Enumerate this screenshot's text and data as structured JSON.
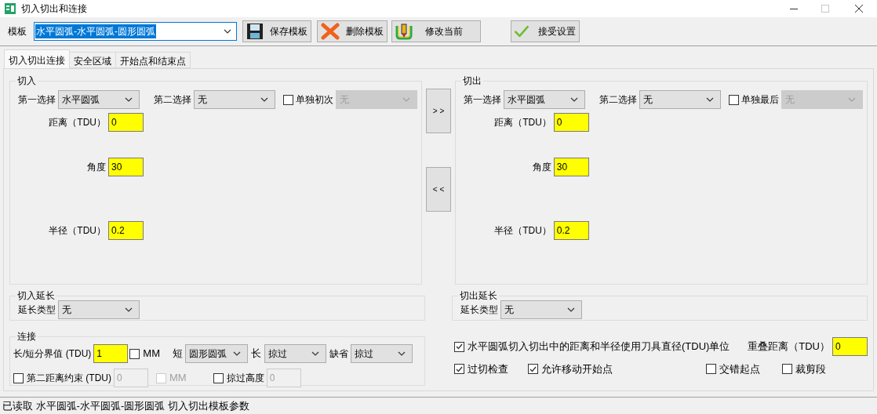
{
  "window": {
    "title": "切入切出和连接"
  },
  "toolbar": {
    "template_label": "模板",
    "template": {
      "value": "水平圆弧-水平圆弧-圆形圆弧",
      "selected": true
    },
    "buttons": [
      {
        "label": "保存模板",
        "kind": "save"
      },
      {
        "label": "删除模板",
        "kind": "delete"
      },
      {
        "label": "修改当前",
        "kind": "modify"
      },
      {
        "label": "接受设置",
        "kind": "accept"
      }
    ]
  },
  "tabs": [
    {
      "label": "切入切出连接",
      "selected": true
    },
    {
      "label": "安全区域",
      "selected": false
    },
    {
      "label": "开始点和结束点",
      "selected": false
    }
  ],
  "lead_in": {
    "title": "切入",
    "first_choice": {
      "label": "第一选择",
      "value": "水平圆弧"
    },
    "second_choice": {
      "label": "第二选择",
      "value": "无"
    },
    "single": {
      "label": "单独初次",
      "checked": false,
      "value": "无",
      "disabled": true
    },
    "fields": [
      {
        "label": "距离（TDU）",
        "value": "0"
      },
      {
        "label": "角度",
        "value": "30"
      },
      {
        "label": "半径（TDU）",
        "value": "0.2"
      }
    ]
  },
  "transfer_buttons": [
    "> >",
    "< <"
  ],
  "lead_out": {
    "title": "切出",
    "first_choice": {
      "label": "第一选择",
      "value": "水平圆弧"
    },
    "second_choice": {
      "label": "第二选择",
      "value": "无"
    },
    "single": {
      "label": "单独最后",
      "checked": false,
      "value": "无",
      "disabled": true
    },
    "fields": [
      {
        "label": "距离（TDU）",
        "value": "0"
      },
      {
        "label": "角度",
        "value": "30"
      },
      {
        "label": "半径（TDU）",
        "value": "0.2"
      }
    ]
  },
  "lead_in_extension": {
    "title": "切入延长",
    "type": {
      "label": "延长类型",
      "value": "无"
    }
  },
  "lead_out_extension": {
    "title": "切出延长",
    "type": {
      "label": "延长类型",
      "value": "无"
    }
  },
  "link": {
    "title": "连接",
    "threshold": {
      "label": "长/短分界值 (TDU)",
      "value": "1"
    },
    "mm": {
      "label": "MM",
      "checked": false,
      "disabled": false
    },
    "short": {
      "label": "短",
      "value": "圆形圆弧"
    },
    "long": {
      "label": "长",
      "value": "掠过"
    },
    "default": {
      "label": "缺省",
      "value": "掠过"
    },
    "second_distance": {
      "label": "第二距离约束 (TDU)",
      "checked": false,
      "value": "0",
      "disabled": true
    },
    "mm2": {
      "label": "MM",
      "checked": false,
      "disabled": true
    },
    "skim_height": {
      "label": "掠过高度",
      "checked": false,
      "value": "0",
      "disabled": true
    }
  },
  "options": {
    "tdu_units": {
      "label": "水平圆弧切入切出中的距离和半径使用刀具直径(TDU)单位",
      "checked": true
    },
    "overlap": {
      "label": "重叠距离（TDU）",
      "value": "0"
    },
    "checks": [
      {
        "label": "过切检查",
        "checked": true
      },
      {
        "label": "允许移动开始点",
        "checked": true
      },
      {
        "label": "交错起点",
        "checked": false
      },
      {
        "label": "裁剪段",
        "checked": false
      }
    ]
  },
  "status_bar": "已读取 水平圆弧-水平圆弧-圆形圆弧 切入切出模板参数"
}
